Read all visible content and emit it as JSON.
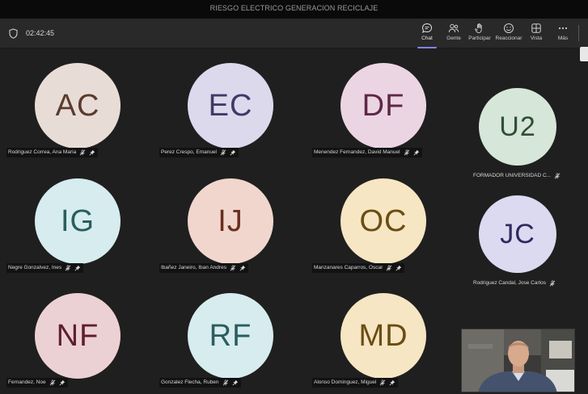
{
  "window": {
    "title": "RIESGO ELECTRICO GENERACION RECICLAJE"
  },
  "toolbar": {
    "timer": "02:42:45",
    "buttons": {
      "chat": "Chat",
      "people": "Gente",
      "raise": "Participar",
      "react": "Reaccionar",
      "view": "Vista",
      "more": "Más"
    }
  },
  "participants": [
    {
      "initials": "AC",
      "name": "Rodriguez Correa, Ana Maria",
      "color": "#e8ddd6",
      "text_color": "#5b3b2f",
      "pinned": true
    },
    {
      "initials": "EC",
      "name": "Perez Crespo, Emanuel",
      "color": "#ddd9ec",
      "text_color": "#3f3a67",
      "pinned": true
    },
    {
      "initials": "DF",
      "name": "Menendez Fernandez, David Manuel",
      "color": "#ecd5e3",
      "text_color": "#5e2747",
      "pinned": true
    },
    {
      "initials": "U2",
      "name": "FORMADOR UNIVERSIDAD C...",
      "color": "#d6e6d8",
      "text_color": "#2f4f34",
      "pinned": false
    },
    {
      "initials": "IG",
      "name": "Negre Gonzalvez, Ines",
      "color": "#d6ecee",
      "text_color": "#2b5c60",
      "pinned": true
    },
    {
      "initials": "IJ",
      "name": "Ibañez Janeiro, Iban Andres",
      "color": "#f1d6cd",
      "text_color": "#6a2e1f",
      "pinned": true
    },
    {
      "initials": "OC",
      "name": "Manzanares Caparros, Oscar",
      "color": "#f7e6c3",
      "text_color": "#6a4d14",
      "pinned": true
    },
    {
      "initials": "JC",
      "name": "Rodriguez Candal, Jose Carlos",
      "color": "#dcdaf0",
      "text_color": "#2e2a5c",
      "pinned": false
    },
    {
      "initials": "NF",
      "name": "Fernandez, Noe",
      "color": "#ecd1d4",
      "text_color": "#5f1f2a",
      "pinned": true
    },
    {
      "initials": "RF",
      "name": "Gonzalez Flecha, Ruben",
      "color": "#d6ecee",
      "text_color": "#2b5c60",
      "pinned": true
    },
    {
      "initials": "MD",
      "name": "Alonso Dominguez, Miguel",
      "color": "#f7e6c3",
      "text_color": "#6a4d14",
      "pinned": true
    }
  ]
}
